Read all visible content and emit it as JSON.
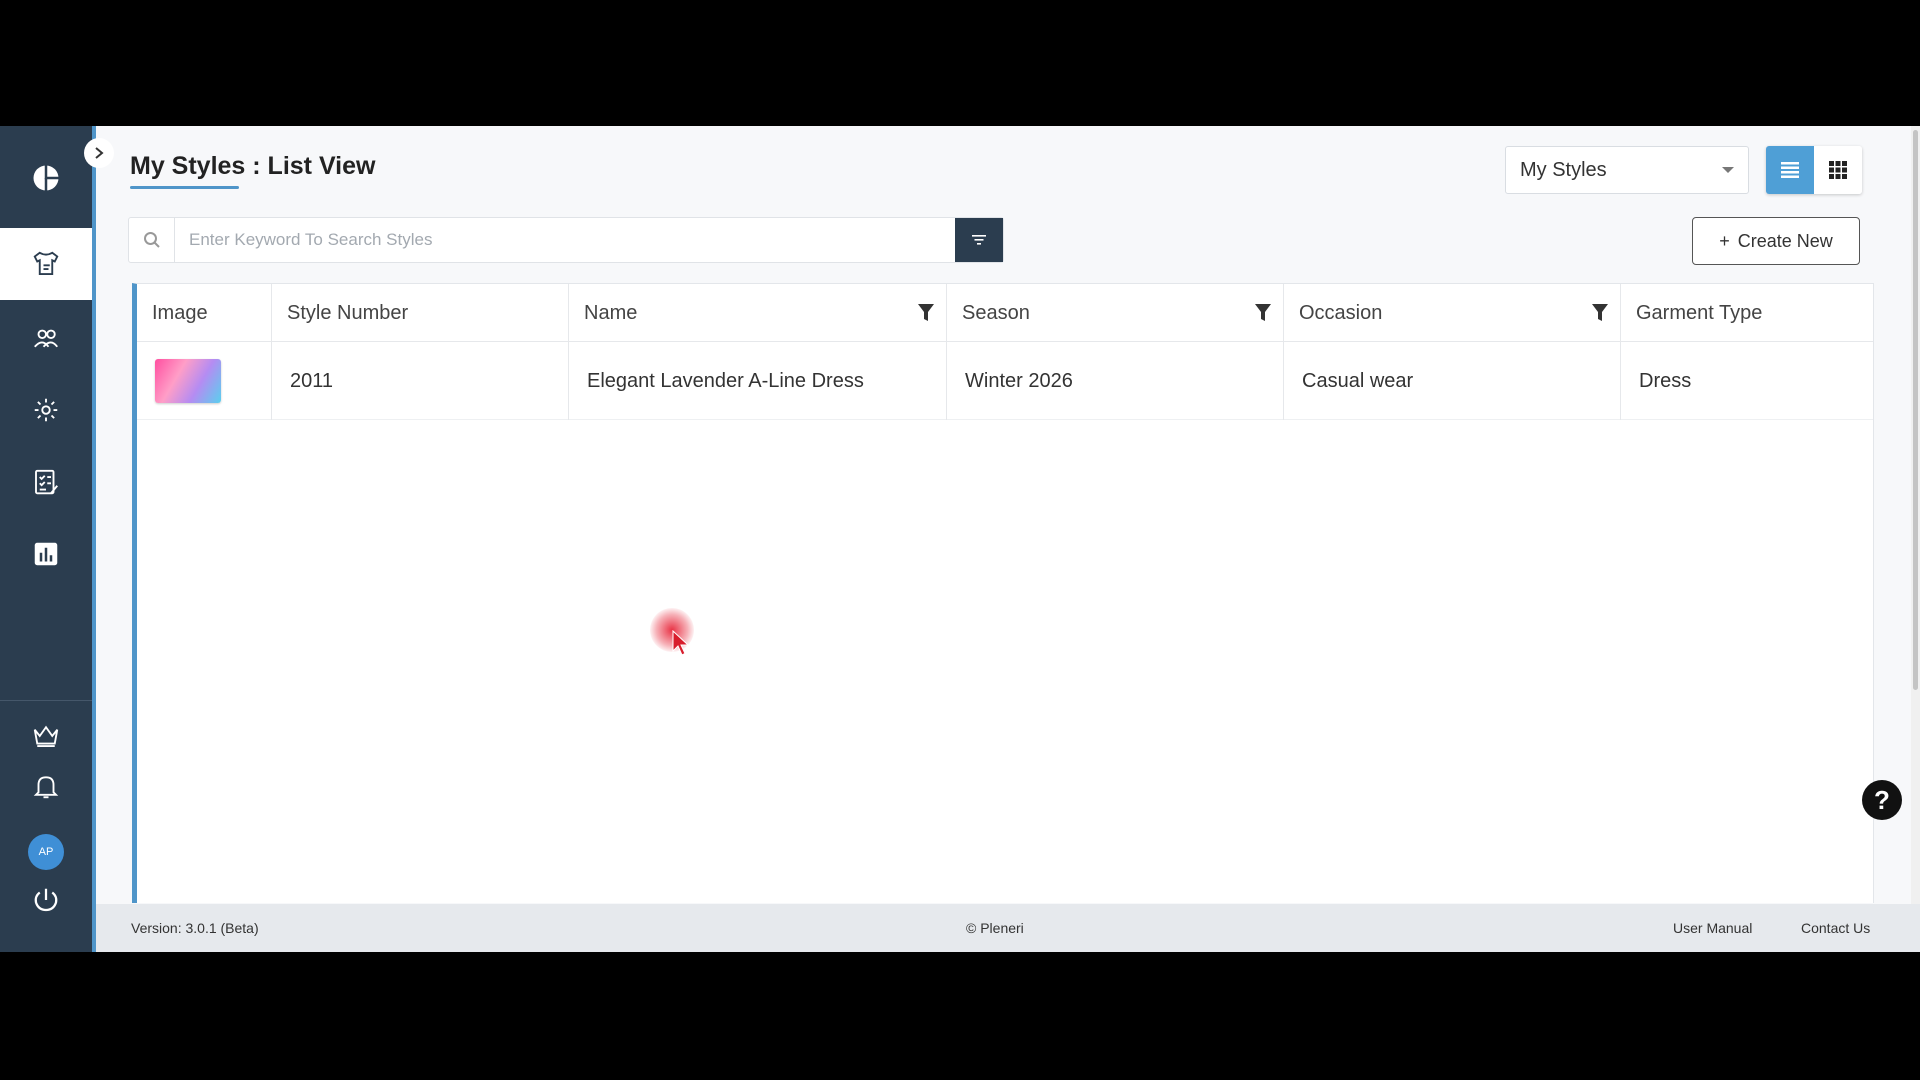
{
  "header": {
    "title": "My Styles : List View",
    "view_select": "My Styles"
  },
  "search": {
    "placeholder": "Enter Keyword To Search Styles",
    "value": ""
  },
  "actions": {
    "create_label": "Create New",
    "create_icon": "+"
  },
  "table": {
    "columns": [
      "Image",
      "Style Number",
      "Name",
      "Season",
      "Occasion",
      "Garment Type"
    ],
    "rows": [
      {
        "style_number": "2011",
        "name": "Elegant Lavender A-Line Dress",
        "season": "Winter 2026",
        "occasion": "Casual wear",
        "garment_type": "Dress"
      }
    ]
  },
  "user": {
    "initials": "AP"
  },
  "footer": {
    "version": "Version: 3.0.1 (Beta)",
    "copyright": "© Pleneri",
    "user_manual": "User Manual",
    "contact_us": "Contact Us"
  },
  "help": {
    "label": "?"
  },
  "colors": {
    "sidebar": "#2b3d4f",
    "accent": "#4f95c9",
    "active_toggle": "#4f9fd6"
  },
  "icons": {
    "sidebar": [
      "dashboard-icon",
      "styles-icon",
      "users-icon",
      "settings-icon",
      "checklist-icon",
      "chart-icon",
      "crown-icon",
      "bell-icon",
      "power-icon"
    ]
  }
}
